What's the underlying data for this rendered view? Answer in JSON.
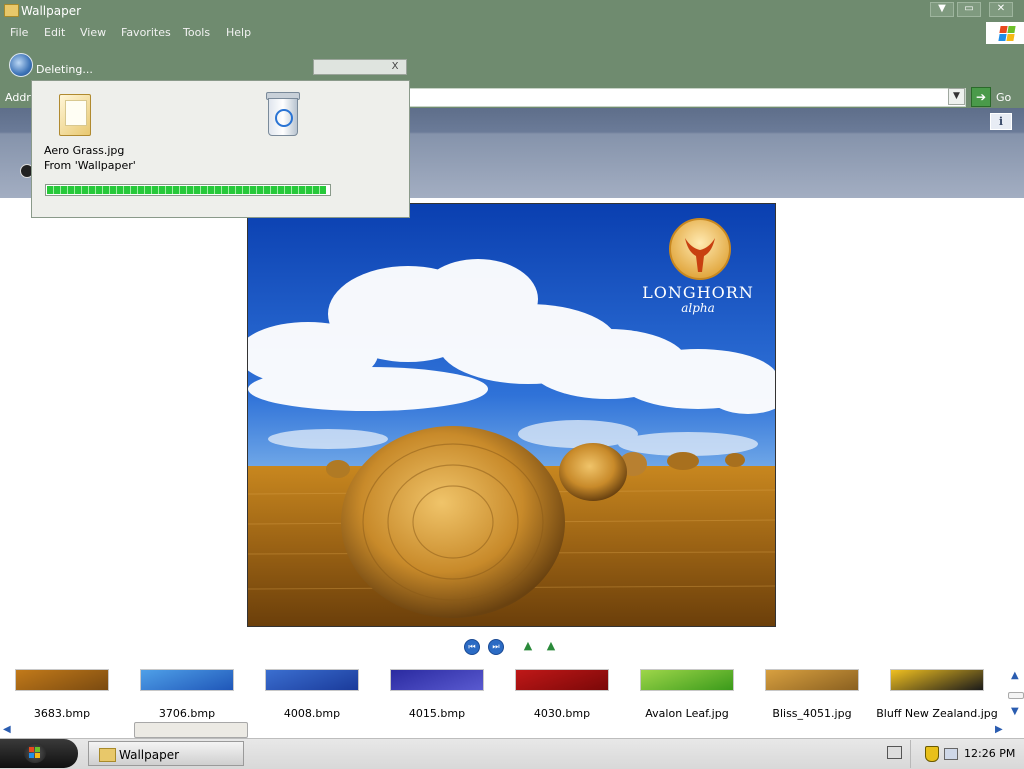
{
  "window": {
    "title": "Wallpaper",
    "menu": [
      "File",
      "Edit",
      "View",
      "Favorites",
      "Tools",
      "Help"
    ],
    "controls": {
      "minimize": "▼",
      "maximize": "▭",
      "close": "✕"
    }
  },
  "address": {
    "label": "Addr",
    "value": "",
    "go_label": "Go"
  },
  "dialog": {
    "title": "Deleting...",
    "file_name": "Aero Grass.jpg",
    "from": "From 'Wallpaper'",
    "close_glyph": "X",
    "progress_fraction": 0.99
  },
  "preview": {
    "logo_title": "LONGHORN",
    "logo_sub": "alpha"
  },
  "nav": {
    "prev": "⏮",
    "next": "⏭"
  },
  "thumbnails": [
    {
      "label": "3683.bmp",
      "colors": [
        "#c27a1a",
        "#7a4a10"
      ]
    },
    {
      "label": "3706.bmp",
      "colors": [
        "#4fa0e8",
        "#1f56b8"
      ]
    },
    {
      "label": "4008.bmp",
      "colors": [
        "#3b6fd0",
        "#1a3a9a"
      ]
    },
    {
      "label": "4015.bmp",
      "colors": [
        "#2a2aa0",
        "#5a5ad0"
      ]
    },
    {
      "label": "4030.bmp",
      "colors": [
        "#c01818",
        "#7a0808"
      ]
    },
    {
      "label": "Avalon Leaf.jpg",
      "colors": [
        "#9ed64a",
        "#3a9a1a"
      ]
    },
    {
      "label": "Bliss_4051.jpg",
      "colors": [
        "#d8a040",
        "#8a6020"
      ]
    },
    {
      "label": "Bluff New Zealand.jpg",
      "colors": [
        "#f0c020",
        "#1a1a1a"
      ]
    }
  ],
  "taskbar": {
    "task_label": "Wallpaper",
    "clock": "12:26 PM"
  },
  "colors": {
    "chrome": "#6f8b6f",
    "progress": "#27c93a",
    "nav_blue": "#2b6bc4"
  }
}
